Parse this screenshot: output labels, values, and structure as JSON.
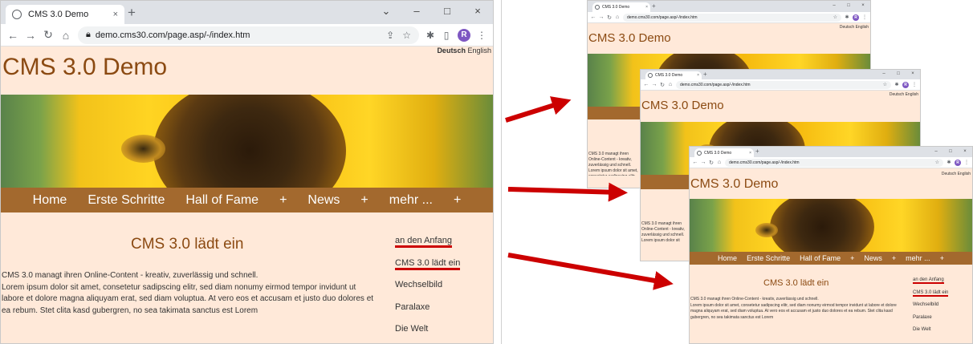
{
  "browser": {
    "tab_title": "CMS 3.0 Demo",
    "tab_close": "×",
    "new_tab": "+",
    "win_min": "–",
    "win_max": "□",
    "win_close": "×",
    "url": "demo.cms30.com/page.asp/-/index.htm",
    "avatar_letter": "R"
  },
  "site": {
    "lang_de": "Deutsch",
    "lang_en": "English",
    "title": "CMS 3.0 Demo",
    "menu": [
      "Home",
      "Erste Schritte",
      "Hall of Fame",
      "+",
      "News",
      "+",
      "mehr ...",
      "+"
    ],
    "content_title": "CMS 3.0 lädt ein",
    "content_line1": "CMS 3.0 managt ihren Online-Content - kreativ, zuverlässig und schnell.",
    "content_body": "Lorem ipsum dolor sit amet, consetetur sadipscing elitr, sed diam nonumy eirmod tempor invidunt ut labore et dolore magna aliquyam erat, sed diam voluptua. At vero eos et accusam et justo duo dolores et ea rebum. Stet clita kasd gubergren, no sea takimata sanctus est Lorem",
    "sidenav": [
      "an den Anfang",
      "CMS 3.0 lädt ein",
      "Wechselbild",
      "Paralaxe",
      "Die Welt"
    ]
  },
  "colors": {
    "page_bg": "#ffe9d9",
    "title_brown": "#8b4a12",
    "menu_bg": "#a3692e",
    "annotation_red": "#cc0000"
  }
}
